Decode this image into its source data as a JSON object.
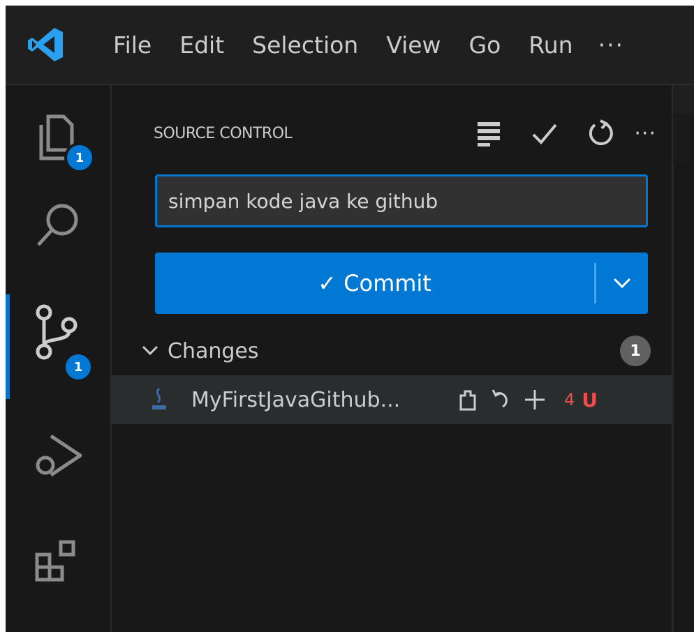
{
  "titlebar": {
    "logo_icon": "vscode-logo-icon",
    "menus": [
      "File",
      "Edit",
      "Selection",
      "View",
      "Go",
      "Run"
    ],
    "more": "···"
  },
  "activitybar": {
    "explorer_badge": "1",
    "scm_badge": "1",
    "accent": "#0078d4"
  },
  "panel": {
    "title": "SOURCE CONTROL",
    "header_icons": [
      "commit-graph-icon",
      "check-icon",
      "refresh-icon"
    ],
    "more": "···",
    "commit_message": "simpan kode java ke github",
    "commit_label": "✓ Commit",
    "changes_label": "Changes",
    "changes_count": "1",
    "file": {
      "name": "MyFirstJavaGithub...",
      "problems": "4",
      "status": "U",
      "status_color": "#f14c4c"
    }
  }
}
